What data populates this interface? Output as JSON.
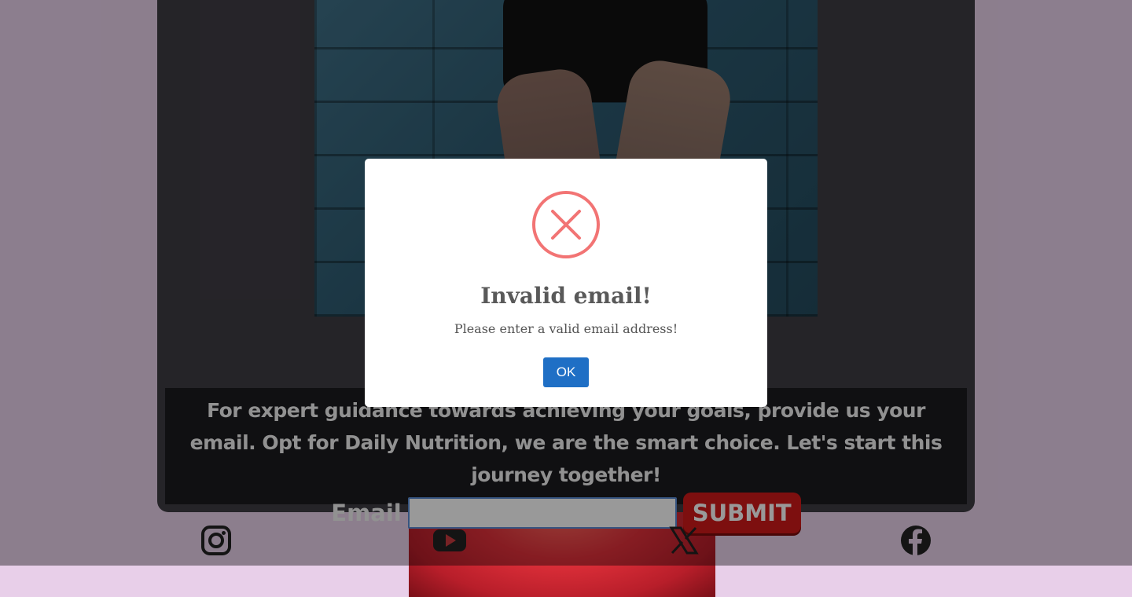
{
  "page": {
    "banner_text": "For expert guidance towards achieving your goals, provide us your email. Opt for Daily Nutrition, we are the smart choice. Let's start this journey together!",
    "email_label": "Email",
    "email_value": "",
    "submit_label": "SUBMIT"
  },
  "socials": [
    {
      "icon": "instagram-icon"
    },
    {
      "icon": "youtube-icon"
    },
    {
      "icon": "x-icon"
    },
    {
      "icon": "facebook-icon"
    }
  ],
  "modal": {
    "icon": "error-x-icon",
    "title": "Invalid email!",
    "text": "Please enter a valid email address!",
    "ok_label": "OK"
  },
  "colors": {
    "overlay": "#000000",
    "error_red": "#f27474",
    "ok_blue": "#1f6fc5",
    "submit_red": "#d11a1a"
  }
}
